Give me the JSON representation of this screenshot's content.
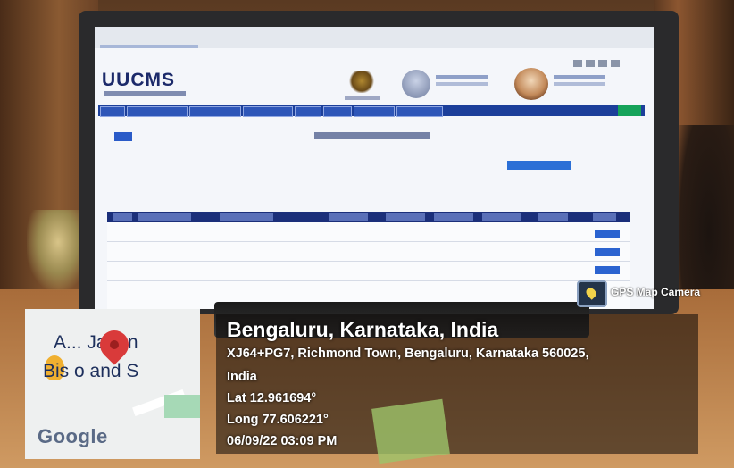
{
  "screen": {
    "app_logo": "UUCMS"
  },
  "gps_overlay": {
    "app_label": "GPS Map Camera",
    "map": {
      "place_text_line1": "A... Japan",
      "place_text_line2": "Bis o and S",
      "provider": "Google"
    },
    "location": {
      "title": "Bengaluru, Karnataka, India",
      "address_line1": "XJ64+PG7, Richmond Town, Bengaluru, Karnataka 560025,",
      "address_line2": "India",
      "latitude": "Lat 12.961694°",
      "longitude": "Long 77.606221°",
      "timestamp": "06/09/22 03:09 PM"
    }
  }
}
